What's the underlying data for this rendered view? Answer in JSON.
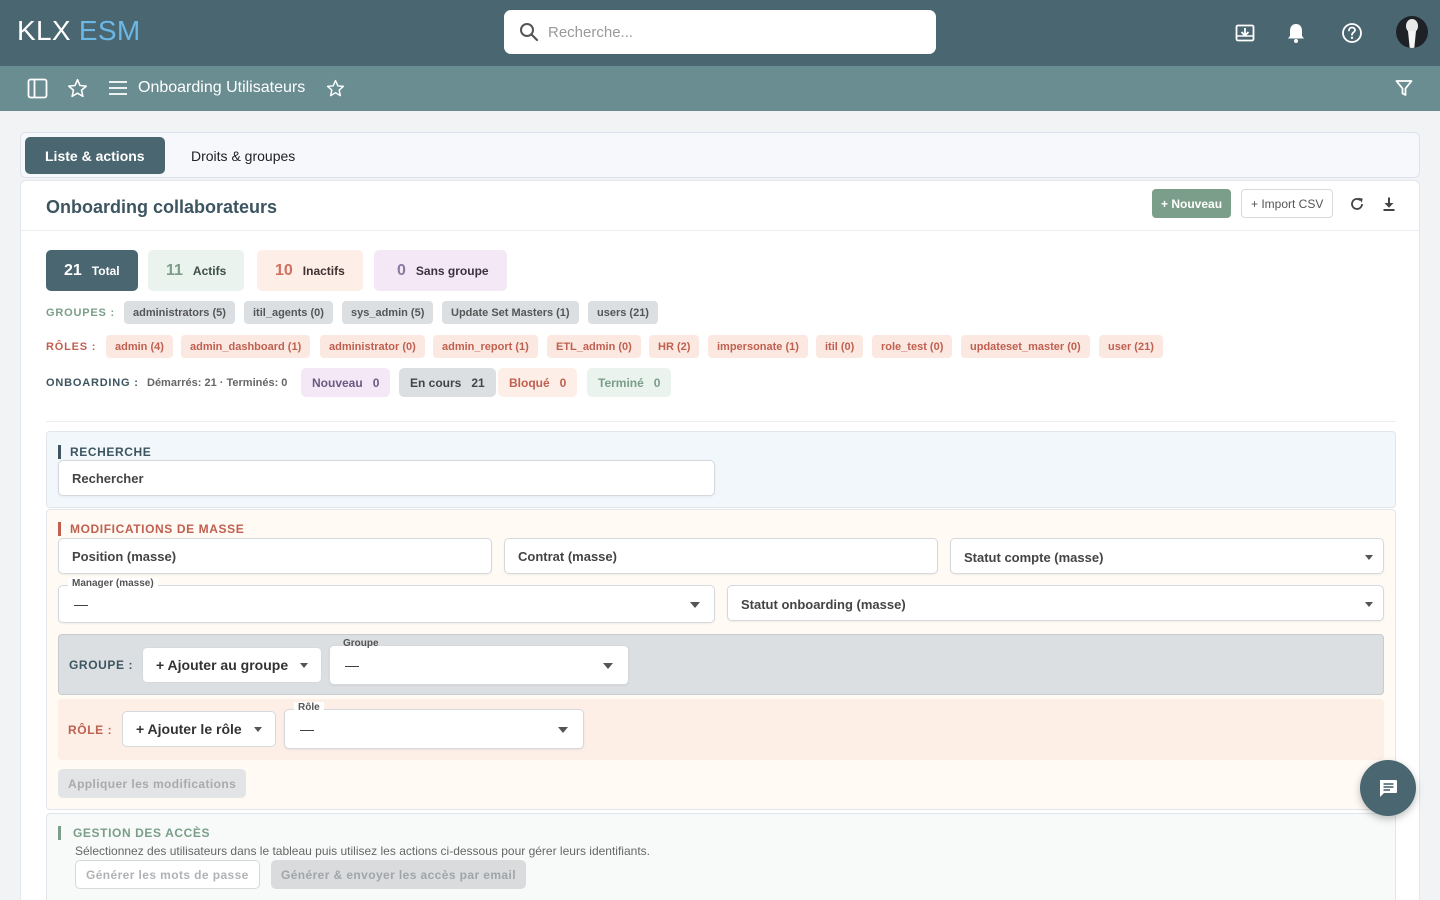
{
  "app": {
    "logo_part1": "KLX",
    "logo_part2": "ESM"
  },
  "search": {
    "placeholder": "Recherche..."
  },
  "subheader": {
    "title": "Onboarding Utilisateurs"
  },
  "tabs": [
    {
      "label": "Liste & actions",
      "active": true
    },
    {
      "label": "Droits & groupes",
      "active": false
    }
  ],
  "panel": {
    "title": "Onboarding collaborateurs",
    "new_button": "+ Nouveau",
    "import_button": "+ Import CSV"
  },
  "stats": [
    {
      "count": "21",
      "label": "Total"
    },
    {
      "count": "11",
      "label": "Actifs"
    },
    {
      "count": "10",
      "label": "Inactifs"
    },
    {
      "count": "0",
      "label": "Sans groupe"
    }
  ],
  "groups": {
    "label": "GROUPES :",
    "items": [
      "administrators (5)",
      "itil_agents (0)",
      "sys_admin (5)",
      "Update Set Masters (1)",
      "users (21)"
    ]
  },
  "roles": {
    "label": "RÔLES :",
    "items": [
      "admin (4)",
      "admin_dashboard (1)",
      "administrator (0)",
      "admin_report (1)",
      "ETL_admin (0)",
      "HR (2)",
      "impersonate (1)",
      "itil (0)",
      "role_test (0)",
      "updateset_master (0)",
      "user (21)"
    ]
  },
  "onboarding": {
    "label": "ONBOARDING :",
    "meta": "Démarrés: 21 · Terminés: 0",
    "statuses": [
      {
        "label": "Nouveau",
        "count": "0"
      },
      {
        "label": "En cours",
        "count": "21"
      },
      {
        "label": "Bloqué",
        "count": "0"
      },
      {
        "label": "Terminé",
        "count": "0"
      }
    ]
  },
  "recherche": {
    "label": "RECHERCHE",
    "placeholder": "Rechercher"
  },
  "mass": {
    "label": "MODIFICATIONS DE MASSE",
    "position_placeholder": "Position (masse)",
    "contrat_placeholder": "Contrat (masse)",
    "statut_compte": "Statut compte (masse)",
    "manager_label": "Manager (masse)",
    "manager_value": "—",
    "statut_onboarding": "Statut onboarding (masse)",
    "group_row": {
      "label": "GROUPE :",
      "action": "+ Ajouter au groupe",
      "field_label": "Groupe",
      "value": "—"
    },
    "role_row": {
      "label": "RÔLE :",
      "action": "+ Ajouter le rôle",
      "field_label": "Rôle",
      "value": "—"
    },
    "apply_button": "Appliquer les modifications"
  },
  "access": {
    "label": "GESTION DES ACCÈS",
    "description": "Sélectionnez des utilisateurs dans le tableau puis utilisez les actions ci-dessous pour gérer leurs identifiants.",
    "generate_button": "Générer les mots de passe",
    "send_button": "Générer & envoyer les accès par email"
  },
  "colors": {
    "header": "#4a6670",
    "subheader": "#6a8d91",
    "accent_blue": "#6bb8e6",
    "success": "#7a9e8a",
    "danger": "#c06050"
  }
}
